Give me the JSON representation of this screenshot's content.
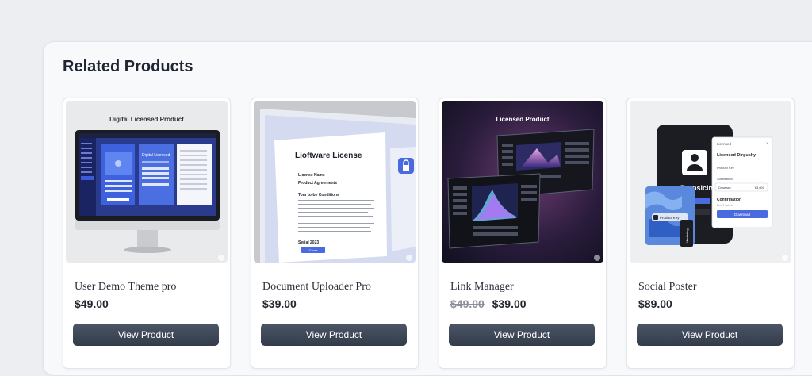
{
  "section": {
    "title": "Related Products"
  },
  "products": [
    {
      "name": "User Demo Theme pro",
      "price": "$49.00",
      "old_price": "",
      "button": "View Product",
      "image": {
        "caption": "Digital Licensed Product",
        "window_title": "Digital Licensed"
      }
    },
    {
      "name": "Document Uploader Pro",
      "price": "$39.00",
      "old_price": "",
      "button": "View Product",
      "image": {
        "doc_title": "Lioftware License",
        "line1": "License Name",
        "line2": "Product Agreements",
        "line3": "Tour to-be Conditions",
        "footer": "Serial 2023",
        "button": "Cover"
      }
    },
    {
      "name": "Link Manager",
      "price": "$39.00",
      "old_price": "$49.00",
      "button": "View Product",
      "image": {
        "caption": "Licensed Product"
      }
    },
    {
      "name": "Social Poster",
      "price": "$89.00",
      "old_price": "",
      "button": "View Product",
      "image": {
        "popup_label": "Licensed",
        "popup_title": "Licensed Dirguslty",
        "row1": "Product Key",
        "row2": "Sustination",
        "field_left": "Dusease",
        "field_right": "¥3,000",
        "confirm": "Confirmation",
        "confirm_sub": "Dete'Fnalres",
        "download": "Download",
        "phone_text": "Brepslcing",
        "tag_text": "Product Key",
        "badge_text": "Marketing"
      }
    }
  ],
  "colors": {
    "accent": "#4a78e0",
    "button_bg": "#3a4353",
    "title": "#1f2433",
    "panel_bg": "#f8f9fb"
  }
}
